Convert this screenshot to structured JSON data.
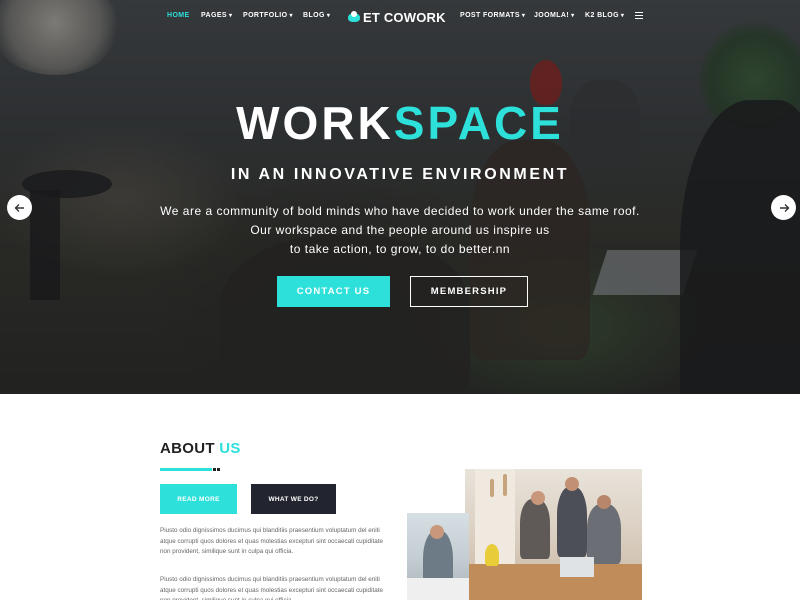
{
  "nav": {
    "items": [
      {
        "label": "HOME",
        "caret": ""
      },
      {
        "label": "PAGES",
        "caret": "▾"
      },
      {
        "label": "PORTFOLIO",
        "caret": "▾"
      },
      {
        "label": "BLOG",
        "caret": "▾"
      },
      {
        "label": "POST FORMATS",
        "caret": "▾"
      },
      {
        "label": "JOOMLA!",
        "caret": "▾"
      },
      {
        "label": "K2 BLOG",
        "caret": "▾"
      }
    ],
    "logo_text": "ET COWORK",
    "accent_color": "#2de0da"
  },
  "hero": {
    "title_part1": "WORK",
    "title_part2": "SPACE",
    "subtitle": "IN AN INNOVATIVE ENVIRONMENT",
    "desc_line1": "We are a community of bold minds who have decided to work under the same roof.",
    "desc_line2": "Our workspace and the people around us inspire us",
    "desc_line3": "to take action, to grow, to do better.nn",
    "btn_contact": "CONTACT US",
    "btn_membership": "MEMBERSHIP"
  },
  "about": {
    "heading_part1": "ABOUT",
    "heading_part2": "US",
    "btn_read": "READ MORE",
    "btn_what": "WHAT WE DO?",
    "p1": "Piusto odio dignissimos ducimus qui blanditiis praesentium voluptatum del eniti atque corrupti quos dolores et quas molestias excepturi sint occaecati cupiditate non provident, similique sunt in culpa qui officia.",
    "p2": "Piusto odio dignissimos ducimus qui blanditiis praesentium voluptatum del eniti atque corrupti quos dolores et quas molestias excepturi sint occaecati cupiditate non provident, similique sunt in culpa qui officia."
  },
  "icons": [
    "menu-icon",
    "arrow-left-icon",
    "arrow-right-icon",
    "logo-icon"
  ]
}
